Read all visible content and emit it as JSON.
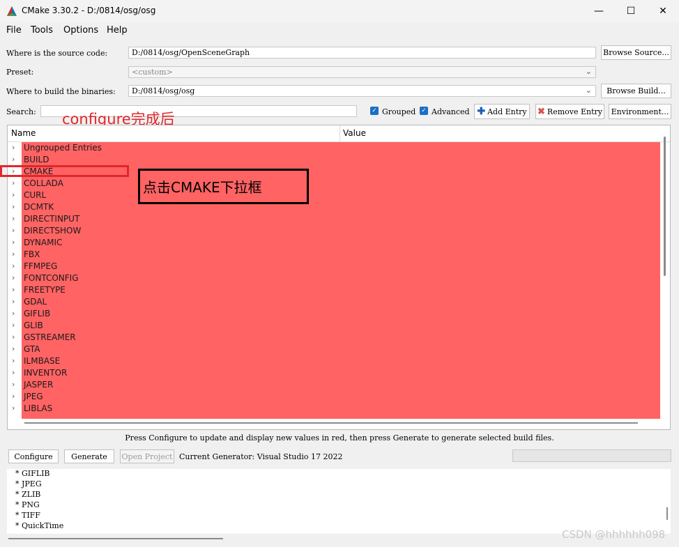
{
  "window": {
    "title": "CMake 3.30.2 - D:/0814/osg/osg",
    "min": "—",
    "max": "☐",
    "close": "✕"
  },
  "menu": [
    "File",
    "Tools",
    "Options",
    "Help"
  ],
  "source": {
    "label": "Where is the source code:",
    "value": "D:/0814/osg/OpenSceneGraph",
    "browse": "Browse Source..."
  },
  "preset": {
    "label": "Preset:",
    "value": "<custom>"
  },
  "build": {
    "label": "Where to build the binaries:",
    "value": "D:/0814/osg/osg",
    "browse": "Browse Build..."
  },
  "search": {
    "label": "Search:",
    "value": ""
  },
  "options": {
    "grouped": {
      "label": "Grouped",
      "checked": true
    },
    "advanced": {
      "label": "Advanced",
      "checked": true
    },
    "add_entry": "Add Entry",
    "remove_entry": "Remove Entry",
    "environment": "Environment..."
  },
  "table": {
    "col_name": "Name",
    "col_value": "Value",
    "rows": [
      "Ungrouped Entries",
      "BUILD",
      "CMAKE",
      "COLLADA",
      "CURL",
      "DCMTK",
      "DIRECTINPUT",
      "DIRECTSHOW",
      "DYNAMIC",
      "FBX",
      "FFMPEG",
      "FONTCONFIG",
      "FREETYPE",
      "GDAL",
      "GIFLIB",
      "GLIB",
      "GSTREAMER",
      "GTA",
      "ILMBASE",
      "INVENTOR",
      "JASPER",
      "JPEG",
      "LIBLAS"
    ],
    "row_color": "#ff6363"
  },
  "annotations": {
    "configure_done": "configure完成后",
    "click_cmake": "点击CMAKE下拉框",
    "color": "#e2262b"
  },
  "hint": "Press Configure to update and display new values in red, then press Generate to generate selected build files.",
  "actions": {
    "configure": "Configure",
    "generate": "Generate",
    "open_project": "Open Project",
    "generator": "Current Generator: Visual Studio 17 2022"
  },
  "output_lines": [
    "* GIFLIB",
    "* JPEG",
    "* ZLIB",
    "* PNG",
    "* TIFF",
    "* QuickTime"
  ],
  "watermark": "CSDN @hhhhhh098"
}
